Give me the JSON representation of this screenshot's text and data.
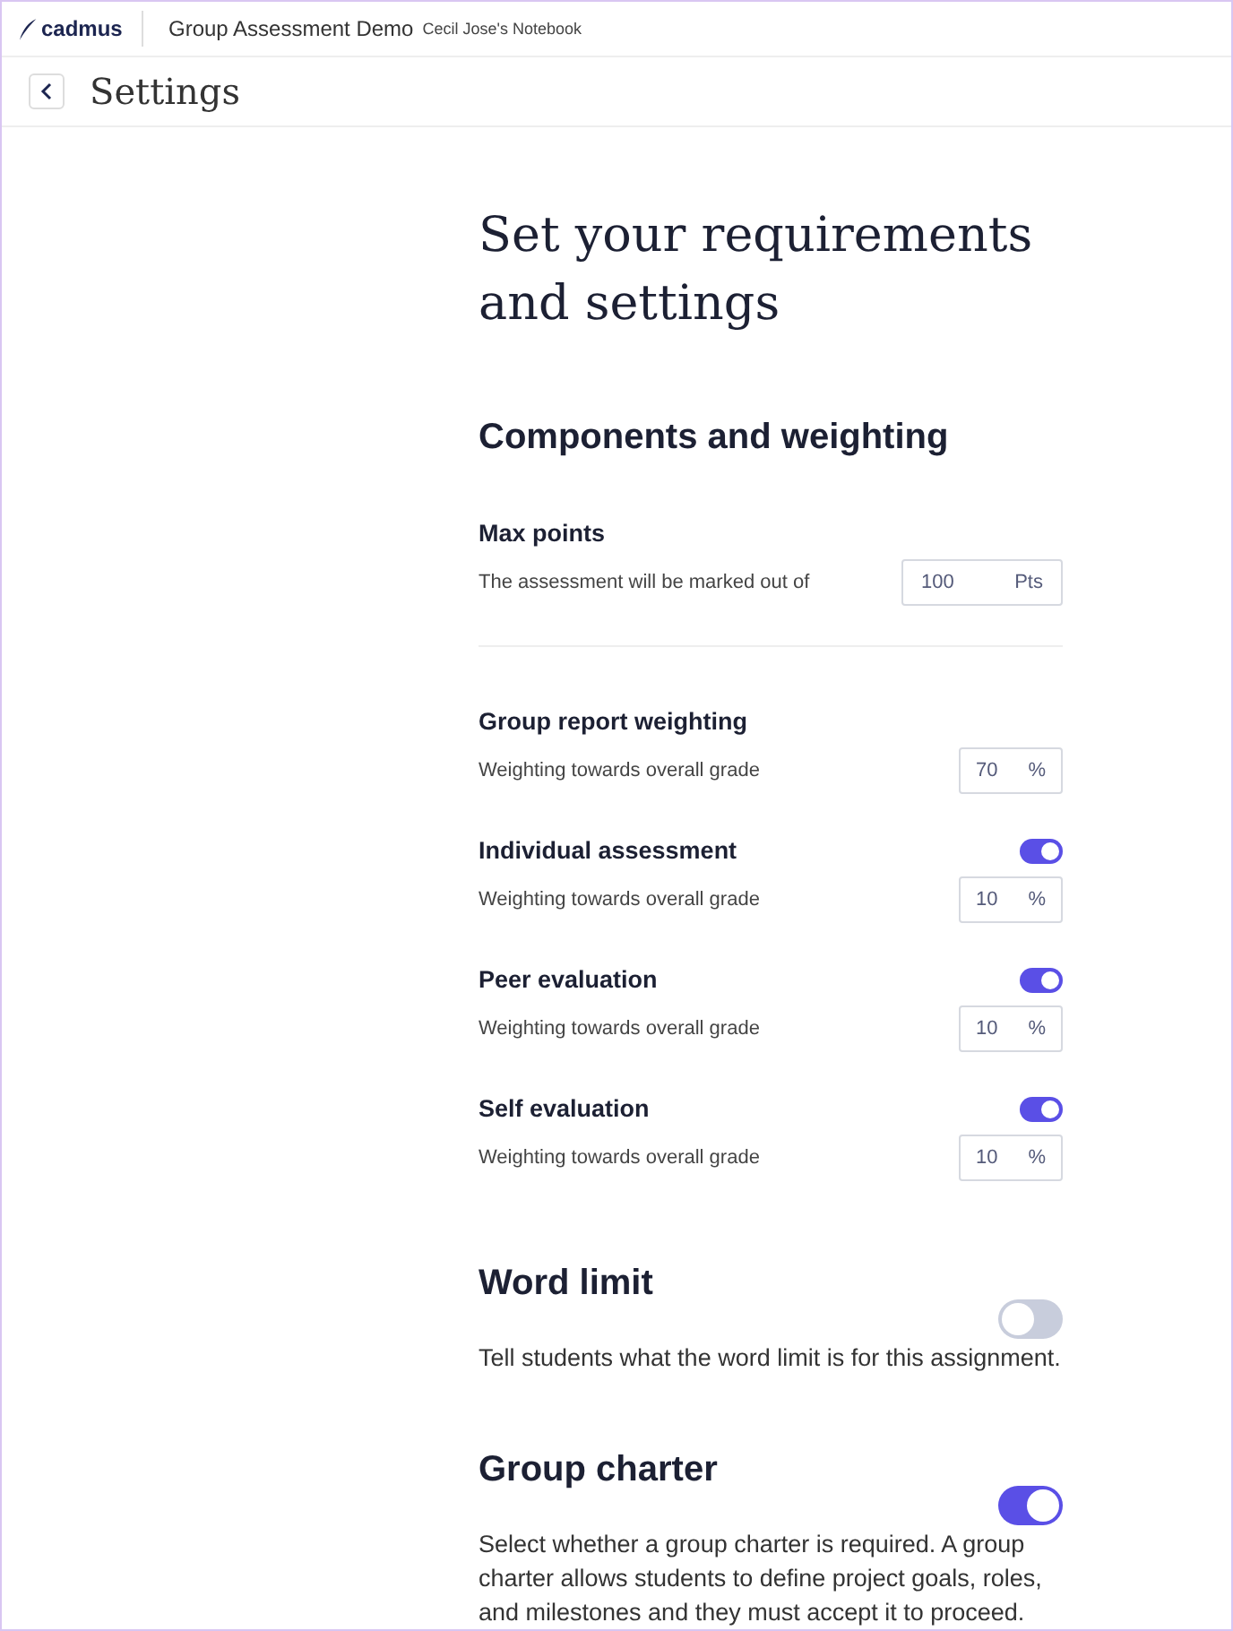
{
  "header": {
    "brand": "cadmus",
    "assessment": "Group Assessment Demo",
    "notebook": "Cecil Jose's Notebook"
  },
  "page_title": "Settings",
  "heading": "Set your requirements and settings",
  "components": {
    "title": "Components and weighting",
    "items": [
      {
        "kind": "field",
        "title": "Max points",
        "description": "The assessment will be marked out of",
        "value": "100",
        "unit": "Pts"
      },
      {
        "kind": "divider"
      },
      {
        "kind": "field",
        "title": "Group report weighting",
        "description": "Weighting towards overall grade",
        "value": "70",
        "unit": "%"
      },
      {
        "kind": "toggle-field",
        "title": "Individual assessment",
        "on": true,
        "description": "Weighting towards overall grade",
        "value": "10",
        "unit": "%"
      },
      {
        "kind": "toggle-field",
        "title": "Peer evaluation",
        "on": true,
        "description": "Weighting towards overall grade",
        "value": "10",
        "unit": "%"
      },
      {
        "kind": "toggle-field",
        "title": "Self evaluation",
        "on": true,
        "description": "Weighting towards overall grade",
        "value": "10",
        "unit": "%"
      }
    ]
  },
  "sections": [
    {
      "title": "Word limit",
      "on": false,
      "description": "Tell students what the word limit is for this assignment."
    },
    {
      "title": "Group charter",
      "on": true,
      "description": "Select whether a group charter is required. A group charter allows students to define project goals, roles, and milestones and they must accept it to proceed."
    }
  ]
}
